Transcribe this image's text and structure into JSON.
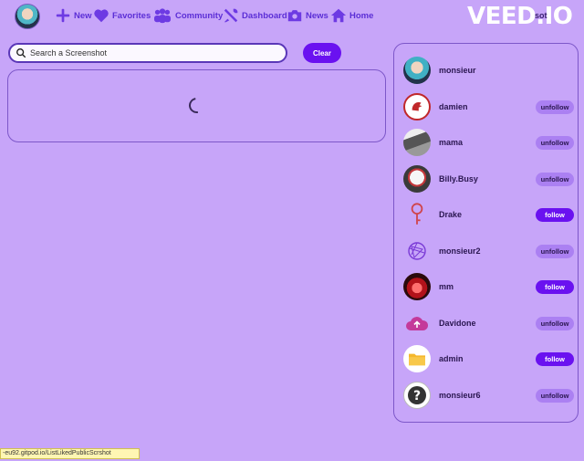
{
  "nav": {
    "items": [
      {
        "label": "New",
        "icon": "plus-icon"
      },
      {
        "label": "Favorites",
        "icon": "heart-icon"
      },
      {
        "label": "Community",
        "icon": "users-icon"
      },
      {
        "label": "Dashboard",
        "icon": "tools-icon"
      },
      {
        "label": "News",
        "icon": "camera-icon"
      },
      {
        "label": "Home",
        "icon": "home-icon"
      }
    ],
    "brand": "VEED.IO",
    "brand_extra": "sot"
  },
  "search": {
    "placeholder": "Search a Screenshot",
    "value": "",
    "clear_label": "Clear"
  },
  "users": [
    {
      "name": "monsieur",
      "button": ""
    },
    {
      "name": "damien",
      "button": "unfollow"
    },
    {
      "name": "mama",
      "button": "unfollow"
    },
    {
      "name": "Billy.Busy",
      "button": "unfollow"
    },
    {
      "name": "Drake",
      "button": "follow"
    },
    {
      "name": "monsieur2",
      "button": "unfollow"
    },
    {
      "name": "mm",
      "button": "follow"
    },
    {
      "name": "Davidone",
      "button": "unfollow"
    },
    {
      "name": "admin",
      "button": "follow"
    },
    {
      "name": "monsieur6",
      "button": "unfollow"
    }
  ],
  "status_url": "-eu92.gitpod.io/ListLikedPublicScrshot",
  "colors": {
    "background": "#c7a5f9",
    "accent": "#6a11f0",
    "unfollow": "#ab80f2"
  }
}
